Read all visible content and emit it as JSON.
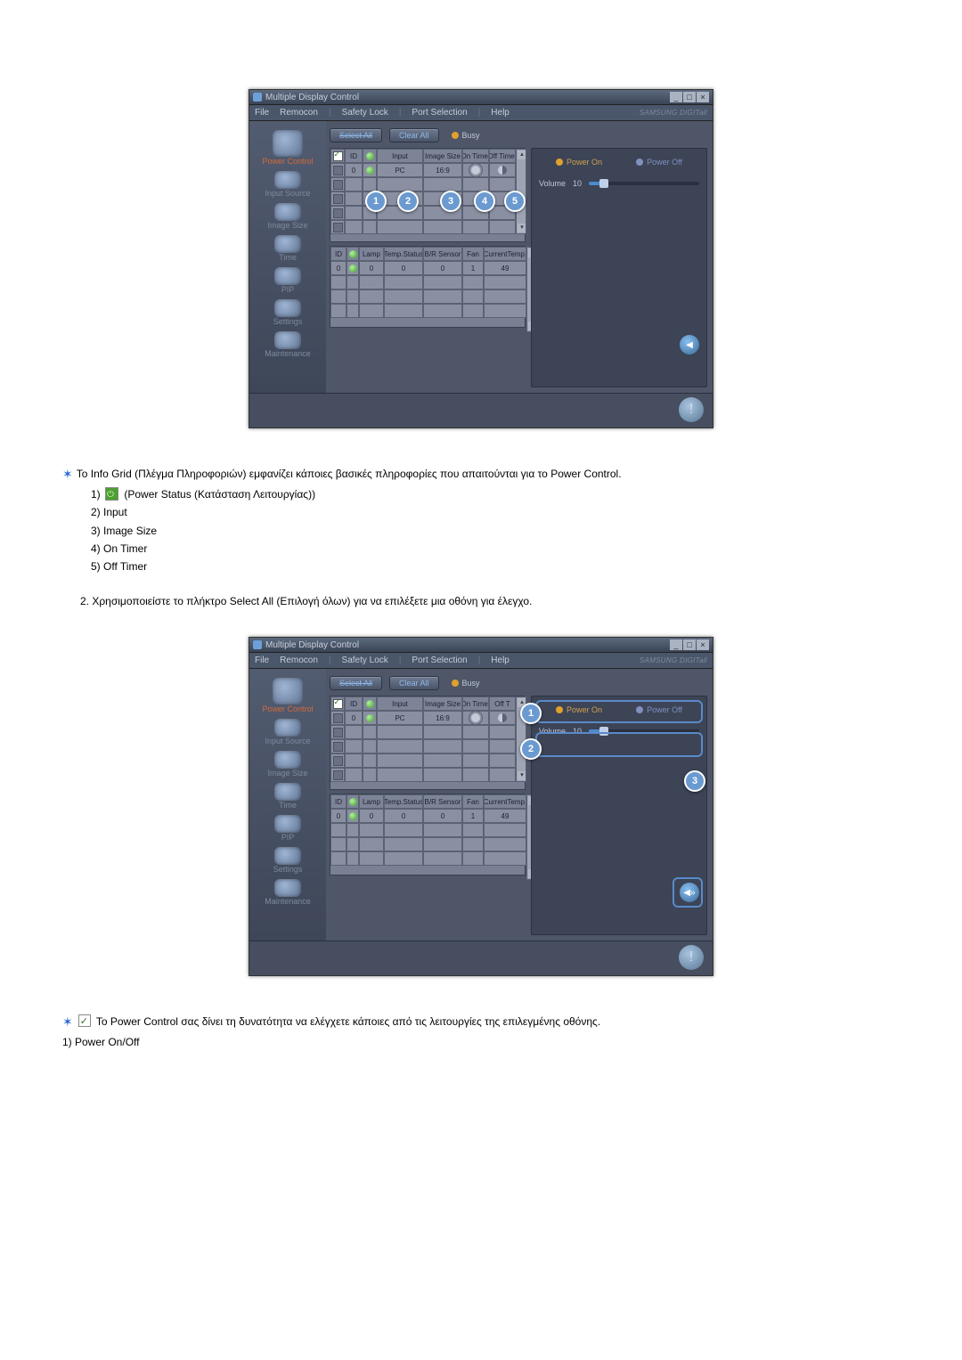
{
  "domain": "Document",
  "app": {
    "title": "Multiple Display Control",
    "menubar": [
      "File",
      "Remocon",
      "Safety Lock",
      "Port Selection",
      "Help"
    ],
    "brand": "SAMSUNG DIGITall"
  },
  "sidebar": {
    "items": [
      {
        "label": "Power Control",
        "active": true
      },
      {
        "label": "Input Source",
        "active": false
      },
      {
        "label": "Image Size",
        "active": false
      },
      {
        "label": "Time",
        "active": false
      },
      {
        "label": "PIP",
        "active": false
      },
      {
        "label": "Settings",
        "active": false
      },
      {
        "label": "Maintenance",
        "active": false
      }
    ]
  },
  "toolbar": {
    "select_all": "Select All",
    "clear_all": "Clear All",
    "busy": "Busy"
  },
  "upperGrid": {
    "headers": [
      "",
      "ID",
      "",
      "Input",
      "Image Size",
      "On Timer",
      "Off Timer"
    ],
    "row0": {
      "id": "0",
      "input": "PC",
      "size": "16:9"
    }
  },
  "lowerGrid": {
    "headers": [
      "ID",
      "",
      "Lamp",
      "Temp.Status",
      "B/R Sensor",
      "Fan",
      "CurrentTemp."
    ],
    "row0": {
      "id": "0",
      "lamp": "0",
      "temp": "0",
      "br": "0",
      "fan": "1",
      "ct": "49"
    }
  },
  "rightPanel": {
    "power_on": "Power On",
    "power_off": "Power Off",
    "volume_label": "Volume",
    "volume_value": "10"
  },
  "callouts_img1": {
    "c1": "1",
    "c2": "2",
    "c3": "3",
    "c4": "4",
    "c5": "5"
  },
  "callouts_img2": {
    "c1": "1",
    "c2": "2",
    "c3": "3"
  },
  "text": {
    "p1": "Το Info Grid (Πλέγμα Πληροφοριών) εμφανίζει κάποιες βασικές πληροφορίες που απαιτούνται για το Power Control.",
    "l1": "1)",
    "l1b": "(Power Status (Κατάσταση Λειτουργίας))",
    "l2": "2) Input",
    "l3": "3) Image Size",
    "l4": "4) On Timer",
    "l5": "5) Off Timer",
    "p2": "2.  Χρησιμοποιείστε το πλήκτρο Select All (Επιλογή όλων) για να επιλέξετε μια οθόνη για έλεγχο.",
    "p3": "Το Power Control σας δίνει τη δυνατότητα να ελέγχετε κάποιες από τις λειτουργίες της επιλεγμένης οθόνης.",
    "p4": "1)  Power On/Off"
  }
}
